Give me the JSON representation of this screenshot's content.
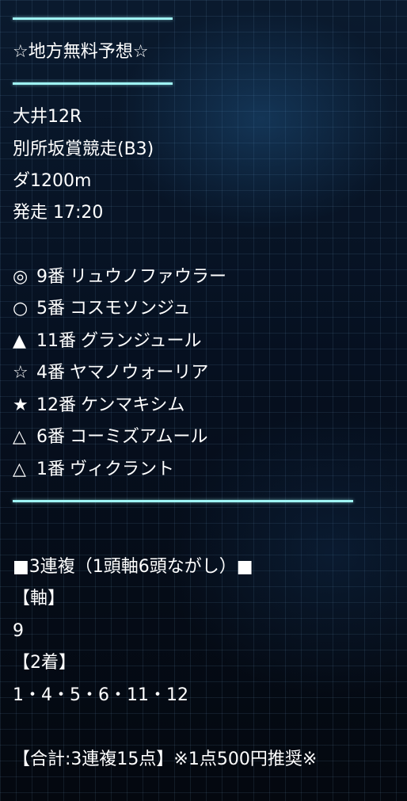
{
  "header": {
    "title": "☆地方無料予想☆"
  },
  "race": {
    "venue_round": "大井12R",
    "name": "別所坂賞競走(B3)",
    "course": "ダ1200m",
    "start": "発走 17:20"
  },
  "picks": [
    {
      "mark": "◎",
      "number": "9番",
      "horse": "リュウノファウラー"
    },
    {
      "mark": "○",
      "number": "5番",
      "horse": "コスモソンジュ"
    },
    {
      "mark": "▲",
      "number": "11番",
      "horse": "グランジュール"
    },
    {
      "mark": "☆",
      "number": "4番",
      "horse": "ヤマノウォーリア"
    },
    {
      "mark": "★",
      "number": "12番",
      "horse": "ケンマキシム"
    },
    {
      "mark": "△",
      "number": "6番",
      "horse": "コーミズアムール"
    },
    {
      "mark": "△",
      "number": "1番",
      "horse": "ヴィクラント"
    }
  ],
  "bet": {
    "heading": "■3連複（1頭軸6頭ながし）■",
    "axis_label": "【軸】",
    "axis_value": "9",
    "second_label": "【2着】",
    "second_value": "1・4・5・6・11・12",
    "summary": "【合計:3連複15点】※1点500円推奨※"
  },
  "colors": {
    "rule": "#9ff4f4",
    "background": "#050a14",
    "text": "#ffffff"
  }
}
